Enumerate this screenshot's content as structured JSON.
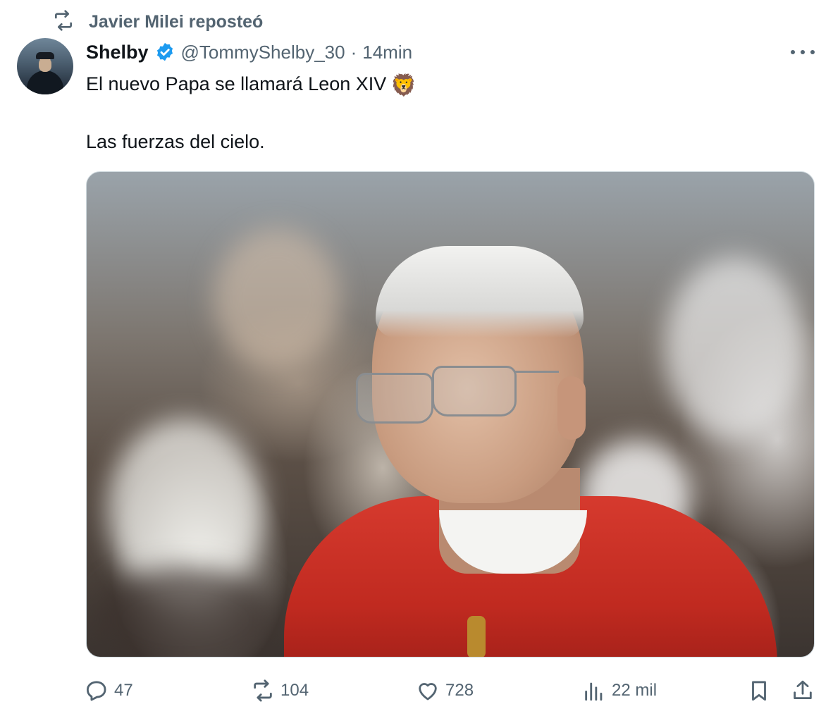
{
  "repost": {
    "text": "Javier Milei reposteó",
    "icon": "repost-icon"
  },
  "author": {
    "display_name": "Shelby",
    "handle": "@TommyShelby_30",
    "separator": "·",
    "time": "14min",
    "verified": true,
    "verified_color": "#1d9bf0"
  },
  "tweet": {
    "line1": "El nuevo Papa se llamará Leon XIV",
    "emoji": "🦁",
    "line2": "Las fuerzas del cielo."
  },
  "actions": {
    "reply": {
      "icon": "reply-icon",
      "count": "47"
    },
    "retweet": {
      "icon": "repost-icon",
      "count": "104"
    },
    "like": {
      "icon": "heart-icon",
      "count": "728"
    },
    "views": {
      "icon": "views-icon",
      "count": "22 mil"
    },
    "bookmark": {
      "icon": "bookmark-icon"
    },
    "share": {
      "icon": "share-icon"
    }
  },
  "colors": {
    "text": "#0f1419",
    "secondary": "#536471",
    "border": "#cfd9de"
  }
}
